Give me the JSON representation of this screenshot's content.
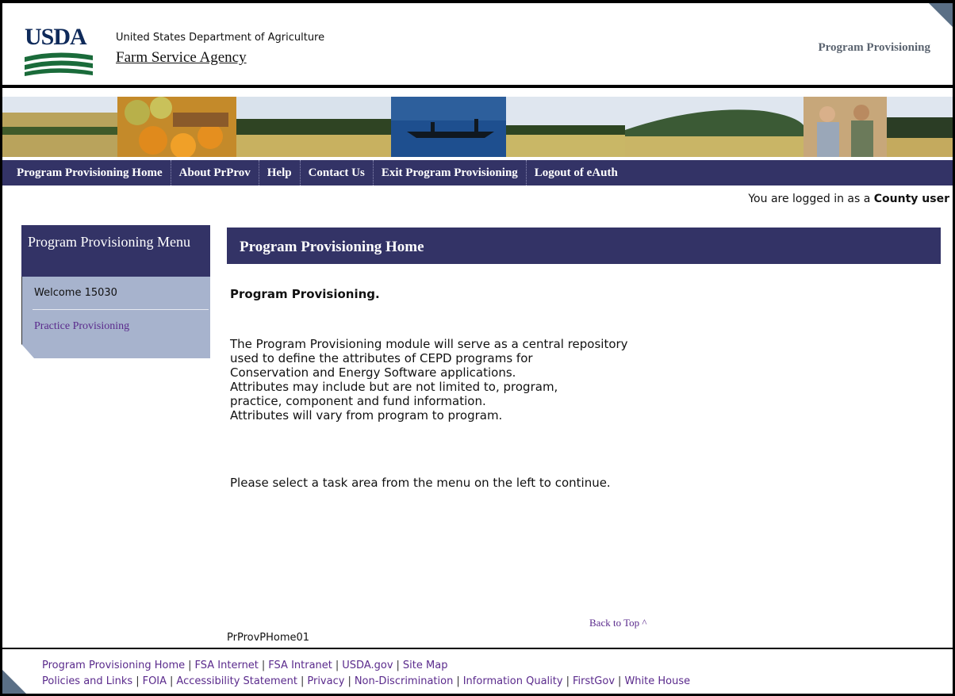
{
  "header": {
    "logo_text": "USDA",
    "department": "United States Department of Agriculture",
    "agency": "Farm Service Agency",
    "app_title": "Program Provisioning"
  },
  "nav": {
    "items": [
      "Program Provisioning Home",
      "About PrProv",
      "Help",
      "Contact Us",
      "Exit Program Provisioning",
      "Logout of eAuth"
    ]
  },
  "login": {
    "prefix": "You are logged in as a ",
    "role": "County user"
  },
  "sidebar": {
    "title": "Program Provisioning Menu",
    "welcome": "Welcome 15030",
    "link": "Practice Provisioning"
  },
  "main": {
    "title": "Program Provisioning Home",
    "heading": "Program Provisioning.",
    "body_lines": [
      "The Program Provisioning module will serve as a central repository",
      "used to define the attributes of CEPD programs for",
      "Conservation and Energy Software applications.",
      "Attributes may include but are not limited to, program,",
      "practice, component and fund information.",
      "Attributes will vary from program to program."
    ],
    "instruction": "Please select a task area from the menu on the left to continue.",
    "back_to_top": "Back to Top ^",
    "page_id": "PrProvPHome01"
  },
  "footer": {
    "row1": [
      "Program Provisioning Home",
      "FSA Internet",
      "FSA Intranet",
      "USDA.gov",
      "Site Map"
    ],
    "row2": [
      "Policies and Links",
      "FOIA",
      "Accessibility Statement",
      "Privacy",
      "Non-Discrimination",
      "Information Quality",
      "FirstGov",
      "White House"
    ]
  },
  "colors": {
    "nav_bg": "#333366",
    "sidebar_bg": "#a7b3cd",
    "link": "#5a2a8c"
  }
}
